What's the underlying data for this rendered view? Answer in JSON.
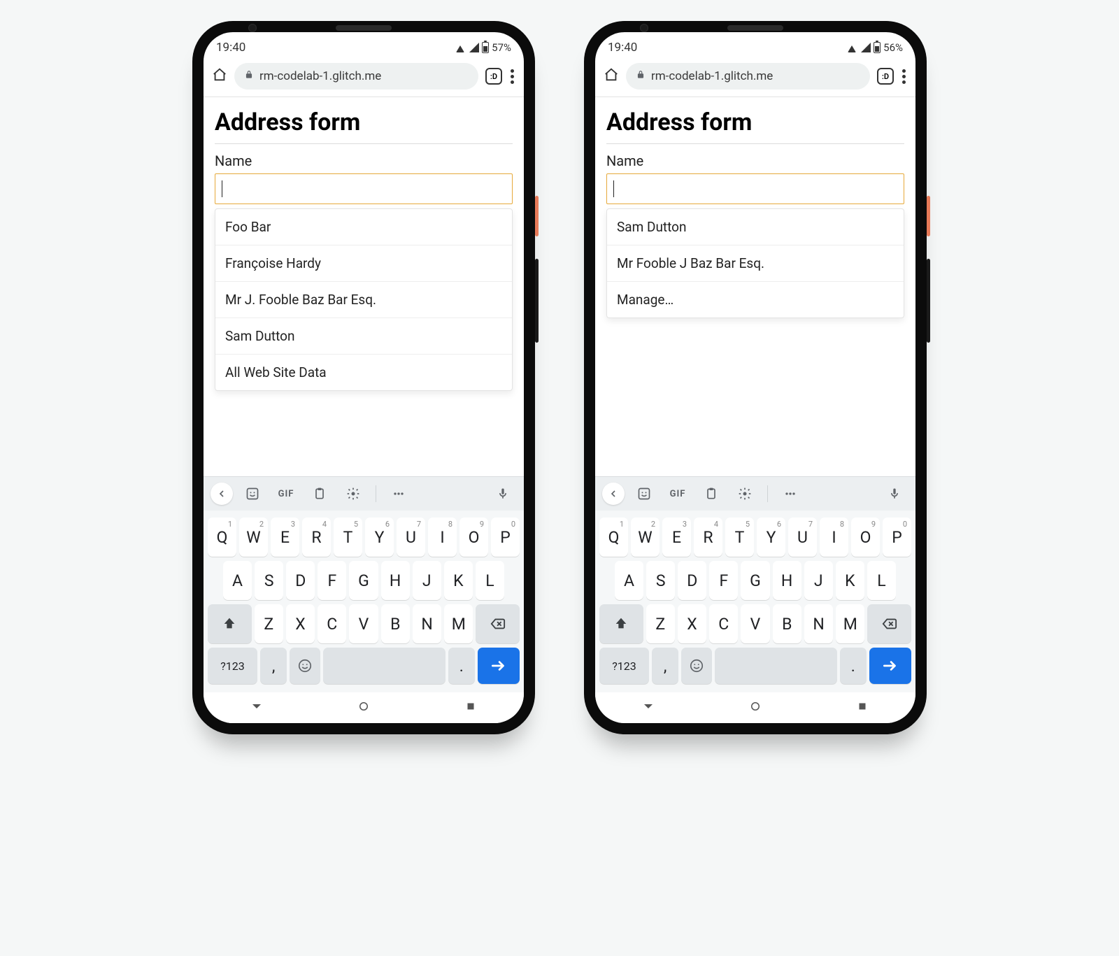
{
  "phones": [
    {
      "status": {
        "time": "19:40",
        "battery": "57%"
      },
      "browser": {
        "url": "rm-codelab-1.glitch.me",
        "tab_icon": ":D"
      },
      "page": {
        "title": "Address form",
        "field_label": "Name",
        "input_value": "",
        "suggestions": [
          "Foo Bar",
          "Françoise Hardy",
          "Mr J. Fooble Baz Bar Esq.",
          "Sam Dutton",
          "All Web Site Data"
        ]
      }
    },
    {
      "status": {
        "time": "19:40",
        "battery": "56%"
      },
      "browser": {
        "url": "rm-codelab-1.glitch.me",
        "tab_icon": ":D"
      },
      "page": {
        "title": "Address form",
        "field_label": "Name",
        "input_value": "",
        "suggestions": [
          "Sam Dutton",
          "Mr Fooble J Baz Bar Esq.",
          "Manage…"
        ]
      }
    }
  ],
  "keyboard": {
    "toolbar_gif": "GIF",
    "row1": [
      {
        "k": "Q",
        "s": "1"
      },
      {
        "k": "W",
        "s": "2"
      },
      {
        "k": "E",
        "s": "3"
      },
      {
        "k": "R",
        "s": "4"
      },
      {
        "k": "T",
        "s": "5"
      },
      {
        "k": "Y",
        "s": "6"
      },
      {
        "k": "U",
        "s": "7"
      },
      {
        "k": "I",
        "s": "8"
      },
      {
        "k": "O",
        "s": "9"
      },
      {
        "k": "P",
        "s": "0"
      }
    ],
    "row2": [
      "A",
      "S",
      "D",
      "F",
      "G",
      "H",
      "J",
      "K",
      "L"
    ],
    "row3": [
      "Z",
      "X",
      "C",
      "V",
      "B",
      "N",
      "M"
    ],
    "sym": "?123",
    "comma": ",",
    "period": "."
  }
}
